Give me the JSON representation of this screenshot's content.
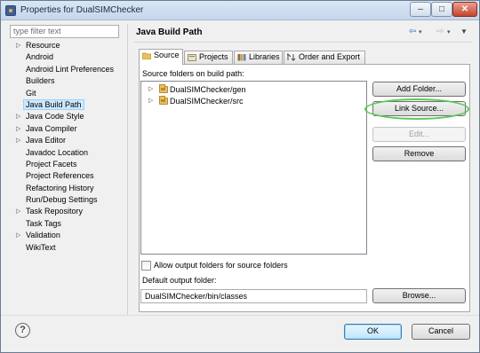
{
  "window": {
    "title": "Properties for DualSIMChecker",
    "minimize": "–",
    "maximize": "□",
    "close": "✕"
  },
  "filter": {
    "placeholder": "type filter text"
  },
  "nav": {
    "items": [
      {
        "label": "Resource",
        "expandable": true
      },
      {
        "label": "Android",
        "expandable": false
      },
      {
        "label": "Android Lint Preferences",
        "expandable": false
      },
      {
        "label": "Builders",
        "expandable": false
      },
      {
        "label": "Git",
        "expandable": false
      },
      {
        "label": "Java Build Path",
        "expandable": false,
        "selected": true
      },
      {
        "label": "Java Code Style",
        "expandable": true
      },
      {
        "label": "Java Compiler",
        "expandable": true
      },
      {
        "label": "Java Editor",
        "expandable": true
      },
      {
        "label": "Javadoc Location",
        "expandable": false
      },
      {
        "label": "Project Facets",
        "expandable": false
      },
      {
        "label": "Project References",
        "expandable": false
      },
      {
        "label": "Refactoring History",
        "expandable": false
      },
      {
        "label": "Run/Debug Settings",
        "expandable": false
      },
      {
        "label": "Task Repository",
        "expandable": true
      },
      {
        "label": "Task Tags",
        "expandable": false
      },
      {
        "label": "Validation",
        "expandable": true
      },
      {
        "label": "WikiText",
        "expandable": false
      }
    ]
  },
  "page": {
    "title": "Java Build Path"
  },
  "history": {
    "back": "⇦",
    "forward": "⇨",
    "dropdown": "▾",
    "menu": "▼"
  },
  "tabs": [
    {
      "label": "Source",
      "active": true
    },
    {
      "label": "Projects",
      "active": false
    },
    {
      "label": "Libraries",
      "active": false
    },
    {
      "label": "Order and Export",
      "active": false
    }
  ],
  "source": {
    "folders_label": "Source folders on build path:",
    "folders": [
      {
        "label": "DualSIMChecker/gen"
      },
      {
        "label": "DualSIMChecker/src"
      }
    ],
    "buttons": {
      "add_folder": "Add Folder...",
      "link_source": "Link Source...",
      "edit": "Edit...",
      "remove": "Remove",
      "browse": "Browse..."
    },
    "allow_output_label": "Allow output folders for source folders",
    "allow_output_checked": false,
    "default_output_label": "Default output folder:",
    "default_output_value": "DualSIMChecker/bin/classes"
  },
  "footer": {
    "help": "?",
    "ok": "OK",
    "cancel": "Cancel"
  }
}
